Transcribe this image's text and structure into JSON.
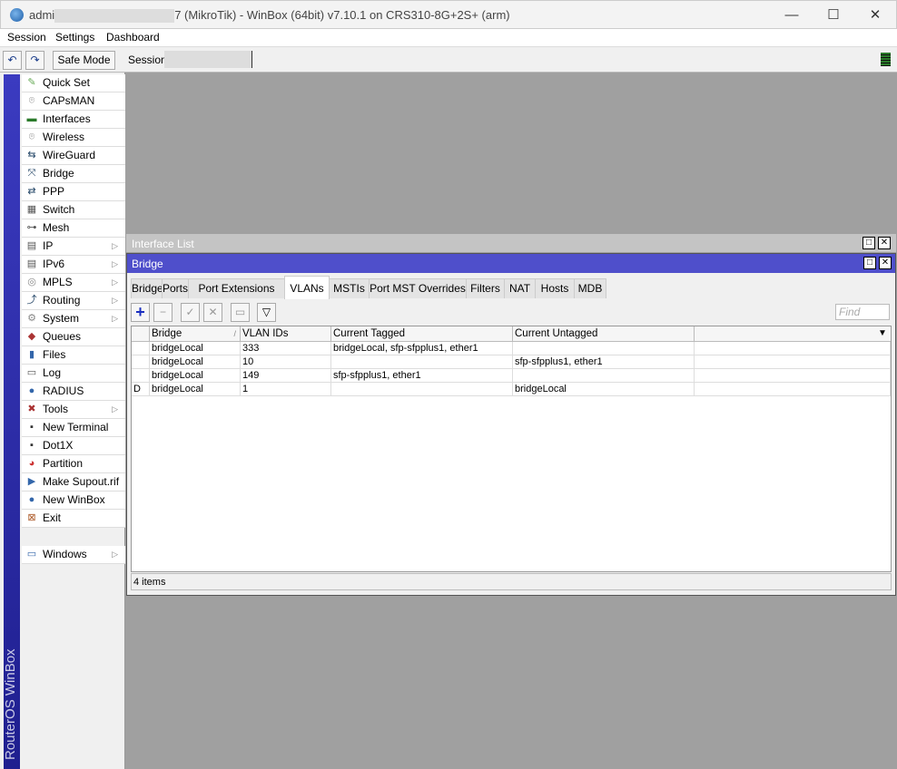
{
  "window": {
    "title_prefix": "admi",
    "title_suffix": "7 (MikroTik) - WinBox (64bit) v7.10.1 on CRS310-8G+2S+ (arm)",
    "minimize": "—",
    "maximize": "☐",
    "close": "✕"
  },
  "menu": [
    "Session",
    "Settings",
    "Dashboard"
  ],
  "toolbar": {
    "undo": "↶",
    "redo": "↷",
    "safe_mode": "Safe Mode",
    "session_label": "Session:"
  },
  "sidebar": {
    "brand": "RouterOS WinBox",
    "items": [
      {
        "label": "Quick Set",
        "icon": "wand-icon",
        "glyph": "✎",
        "color": "#6a5"
      },
      {
        "label": "CAPsMAN",
        "icon": "antenna-icon",
        "glyph": "⌾",
        "color": "#888"
      },
      {
        "label": "Interfaces",
        "icon": "interface-icon",
        "glyph": "▬",
        "color": "#2a7a2a"
      },
      {
        "label": "Wireless",
        "icon": "wireless-icon",
        "glyph": "⌾",
        "color": "#888"
      },
      {
        "label": "WireGuard",
        "icon": "wireguard-icon",
        "glyph": "⇆",
        "color": "#246"
      },
      {
        "label": "Bridge",
        "icon": "bridge-icon",
        "glyph": "⤧",
        "color": "#246"
      },
      {
        "label": "PPP",
        "icon": "ppp-icon",
        "glyph": "⇄",
        "color": "#246"
      },
      {
        "label": "Switch",
        "icon": "switch-icon",
        "glyph": "▦",
        "color": "#555"
      },
      {
        "label": "Mesh",
        "icon": "mesh-icon",
        "glyph": "⊶",
        "color": "#555"
      },
      {
        "label": "IP",
        "icon": "ip-icon",
        "glyph": "▤",
        "color": "#555",
        "sub": true
      },
      {
        "label": "IPv6",
        "icon": "ipv6-icon",
        "glyph": "▤",
        "color": "#555",
        "sub": true
      },
      {
        "label": "MPLS",
        "icon": "mpls-icon",
        "glyph": "◎",
        "color": "#888",
        "sub": true
      },
      {
        "label": "Routing",
        "icon": "routing-icon",
        "glyph": "⤴",
        "color": "#246",
        "sub": true
      },
      {
        "label": "System",
        "icon": "system-icon",
        "glyph": "⚙",
        "color": "#888",
        "sub": true
      },
      {
        "label": "Queues",
        "icon": "queues-icon",
        "glyph": "◆",
        "color": "#a33"
      },
      {
        "label": "Files",
        "icon": "files-icon",
        "glyph": "▮",
        "color": "#36a"
      },
      {
        "label": "Log",
        "icon": "log-icon",
        "glyph": "▭",
        "color": "#555"
      },
      {
        "label": "RADIUS",
        "icon": "radius-icon",
        "glyph": "●",
        "color": "#36a"
      },
      {
        "label": "Tools",
        "icon": "tools-icon",
        "glyph": "✖",
        "color": "#a33",
        "sub": true
      },
      {
        "label": "New Terminal",
        "icon": "terminal-icon",
        "glyph": "▪",
        "color": "#333"
      },
      {
        "label": "Dot1X",
        "icon": "dot1x-icon",
        "glyph": "▪",
        "color": "#333"
      },
      {
        "label": "Partition",
        "icon": "partition-icon",
        "glyph": "◕",
        "color": "#c33"
      },
      {
        "label": "Make Supout.rif",
        "icon": "supout-icon",
        "glyph": "▶",
        "color": "#36a"
      },
      {
        "label": "New WinBox",
        "icon": "winbox-icon",
        "glyph": "●",
        "color": "#36a"
      },
      {
        "label": "Exit",
        "icon": "exit-icon",
        "glyph": "⊠",
        "color": "#a52"
      }
    ],
    "windows": {
      "label": "Windows",
      "icon": "windows-icon",
      "glyph": "▭",
      "color": "#36a"
    }
  },
  "interface_list": {
    "title": "Interface List"
  },
  "bridge_window": {
    "title": "Bridge",
    "tabs": [
      "Bridge",
      "Ports",
      "Port Extensions",
      "VLANs",
      "MSTIs",
      "Port MST Overrides",
      "Filters",
      "NAT",
      "Hosts",
      "MDB"
    ],
    "active_tab": "VLANs",
    "find_placeholder": "Find",
    "columns": [
      "",
      "Bridge",
      "VLAN IDs",
      "Current Tagged",
      "Current Untagged"
    ],
    "rows": [
      {
        "flag": "",
        "bridge": "bridgeLocal",
        "vlan_ids": "333",
        "tagged": "bridgeLocal, sfp-sfpplus1, ether1",
        "untagged": ""
      },
      {
        "flag": "",
        "bridge": "bridgeLocal",
        "vlan_ids": "10",
        "tagged": "",
        "untagged": "sfp-sfpplus1, ether1"
      },
      {
        "flag": "",
        "bridge": "bridgeLocal",
        "vlan_ids": "149",
        "tagged": "sfp-sfpplus1, ether1",
        "untagged": ""
      },
      {
        "flag": "D",
        "bridge": "bridgeLocal",
        "vlan_ids": "1",
        "tagged": "",
        "untagged": "bridgeLocal"
      }
    ],
    "status": "4 items"
  }
}
